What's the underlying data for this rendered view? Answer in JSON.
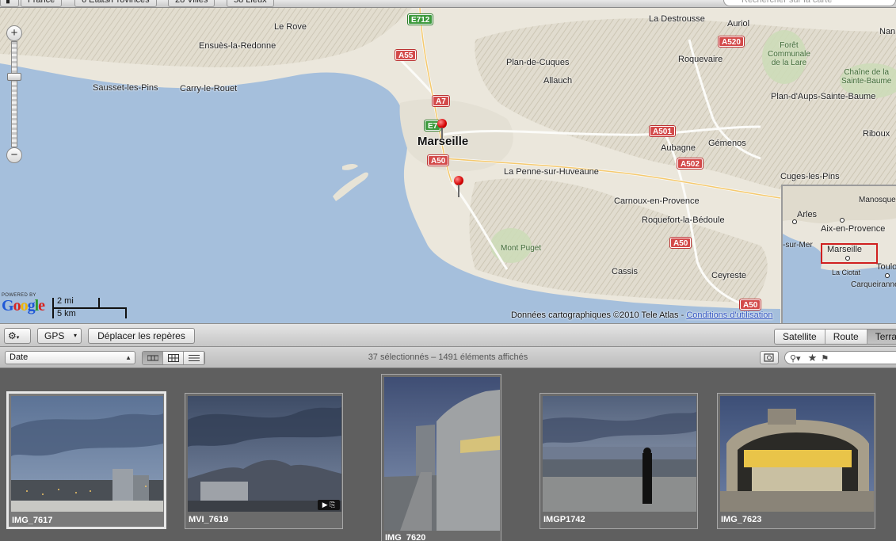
{
  "crumbs": {
    "country": "France",
    "states": "6 États/Provinces",
    "cities": "28 Villes",
    "places": "58 Lieux",
    "search_placeholder": "Rechercher sur la carte"
  },
  "map": {
    "labels": {
      "le_rove": "Le Rove",
      "ensues": "Ensuès-la-Redonne",
      "sausset": "Sausset-les-Pins",
      "carry": "Carry-le-Rouet",
      "marseille": "Marseille",
      "plan_de_cuques": "Plan-de-Cuques",
      "allauch": "Allauch",
      "la_destrousse": "La Destrousse",
      "auriol": "Auriol",
      "roquevaire": "Roquevaire",
      "foret": "Forêt\nCommunale\nde la Lare",
      "chaine": "Chaîne de la\nSainte-Baume",
      "plan_daups": "Plan-d'Aups-Sainte-Baume",
      "riboux": "Riboux",
      "gemenos": "Gémenos",
      "aubagne": "Aubagne",
      "la_penne": "La Penne-sur-Huveaune",
      "carnoux": "Carnoux-en-Provence",
      "roquefort": "Roquefort-la-Bédoule",
      "cuges": "Cuges-les-Pins",
      "mont_puget": "Mont Puget",
      "cassis": "Cassis",
      "ceyreste": "Ceyreste",
      "nans": "Nan"
    },
    "roads": {
      "e712": "E712",
      "a55": "A55",
      "a7": "A7",
      "e7": "E7",
      "a50_1": "A50",
      "a501": "A501",
      "a502": "A502",
      "a50_2": "A50",
      "a50_3": "A50",
      "a520": "A520"
    },
    "google": {
      "powered": "POWERED BY",
      "word": "Google"
    },
    "scale": {
      "mi": "2 mi",
      "km": "5 km"
    },
    "copyright": "Données cartographiques ©2010 Tele Atlas - ",
    "terms": "Conditions d'utilisation",
    "overview": {
      "manosque": "Manosque",
      "arles": "Arles",
      "aix": "Aix-en-Provence",
      "sur_mer": "-sur-Mer",
      "marseille": "Marseille",
      "toulon": "Toulo",
      "la_ciotat": "La Ciotat",
      "carqueiranne": "Carqueiranne"
    }
  },
  "toolbar": {
    "gps_label": "GPS",
    "move_pins_label": "Déplacer les repères",
    "map_types": [
      "Satellite",
      "Route",
      "Terra"
    ],
    "active_map_type": 2
  },
  "sortbar": {
    "sort_value": "Date",
    "status": "37 sélectionnés – 1491 éléments affichés"
  },
  "photos": [
    {
      "name": "IMG_7617",
      "selected": true
    },
    {
      "name": "MVI_7619",
      "selected": false,
      "badge": "▶ ⎘"
    },
    {
      "name": "IMG_7620",
      "selected": false
    },
    {
      "name": "IMGP1742",
      "selected": false
    },
    {
      "name": "IMG_7623",
      "selected": false
    }
  ],
  "colors": {
    "sea": "#a5bfdc",
    "land": "#ece8de",
    "road_shield": "#d34a4a",
    "overview_box": "#d02020"
  }
}
